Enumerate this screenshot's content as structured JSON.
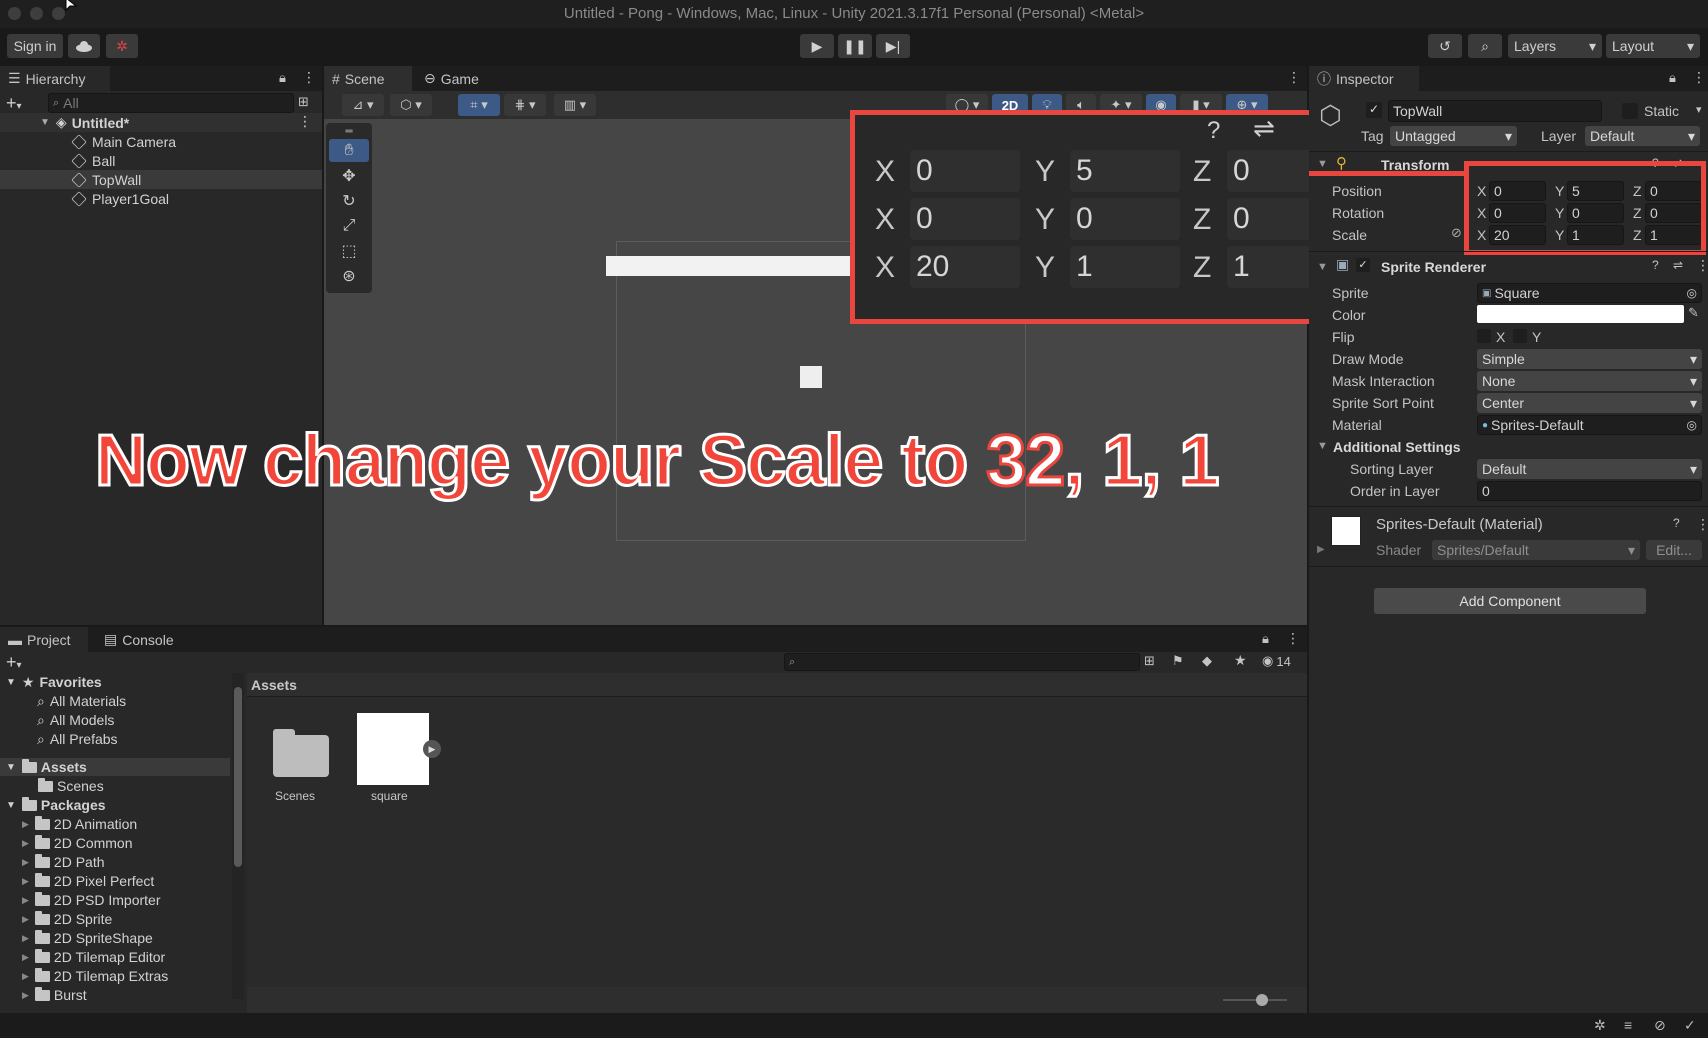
{
  "window": {
    "title": "Untitled - Pong - Windows, Mac, Linux - Unity 2021.3.17f1 Personal (Personal) <Metal>"
  },
  "toolbar": {
    "sign_in": "Sign in",
    "layers": "Layers",
    "layout": "Layout"
  },
  "hierarchy": {
    "tab": "Hierarchy",
    "search_placeholder": "All",
    "scene_name": "Untitled*",
    "items": [
      "Main Camera",
      "Ball",
      "TopWall",
      "Player1Goal"
    ],
    "selected": "TopWall"
  },
  "scene": {
    "tabs": [
      "Scene",
      "Game"
    ],
    "mode_2d": "2D",
    "zoomed": {
      "position": {
        "x": "0",
        "y": "5",
        "z": "0"
      },
      "rotation": {
        "x": "0",
        "y": "0",
        "z": "0"
      },
      "scale": {
        "x": "20",
        "y": "1",
        "z": "1"
      }
    }
  },
  "overlay": {
    "text_before": "Now change your Scale to ",
    "highlight": "32",
    "text_after": ", 1, 1"
  },
  "inspector": {
    "tab": "Inspector",
    "object_name": "TopWall",
    "static_label": "Static",
    "tag_label": "Tag",
    "tag_value": "Untagged",
    "layer_label": "Layer",
    "layer_value": "Default",
    "transform": {
      "title": "Transform",
      "position_label": "Position",
      "rotation_label": "Rotation",
      "scale_label": "Scale",
      "position": {
        "x": "0",
        "y": "5",
        "z": "0"
      },
      "rotation": {
        "x": "0",
        "y": "0",
        "z": "0"
      },
      "scale": {
        "x": "20",
        "y": "1",
        "z": "1"
      }
    },
    "sprite_renderer": {
      "title": "Sprite Renderer",
      "sprite_label": "Sprite",
      "sprite_value": "Square",
      "color_label": "Color",
      "flip_label": "Flip",
      "flip_x": "X",
      "flip_y": "Y",
      "draw_mode_label": "Draw Mode",
      "draw_mode_value": "Simple",
      "mask_label": "Mask Interaction",
      "mask_value": "None",
      "sort_point_label": "Sprite Sort Point",
      "sort_point_value": "Center",
      "material_label": "Material",
      "material_value": "Sprites-Default",
      "additional_label": "Additional Settings",
      "sorting_layer_label": "Sorting Layer",
      "sorting_layer_value": "Default",
      "order_label": "Order in Layer",
      "order_value": "0"
    },
    "material": {
      "title": "Sprites-Default (Material)",
      "shader_label": "Shader",
      "shader_value": "Sprites/Default",
      "edit_label": "Edit..."
    },
    "add_component": "Add Component"
  },
  "project": {
    "tabs": [
      "Project",
      "Console"
    ],
    "hidden_count": "14",
    "breadcrumb": "Assets",
    "favorites_label": "Favorites",
    "favorites": [
      "All Materials",
      "All Models",
      "All Prefabs"
    ],
    "assets_label": "Assets",
    "assets_children": [
      "Scenes"
    ],
    "packages_label": "Packages",
    "packages": [
      "2D Animation",
      "2D Common",
      "2D Path",
      "2D Pixel Perfect",
      "2D PSD Importer",
      "2D Sprite",
      "2D SpriteShape",
      "2D Tilemap Editor",
      "2D Tilemap Extras",
      "Burst"
    ],
    "grid_items": [
      "Scenes",
      "square"
    ]
  },
  "colors": {
    "accent_red": "#e8463f",
    "selection_blue": "#3d5a87"
  }
}
